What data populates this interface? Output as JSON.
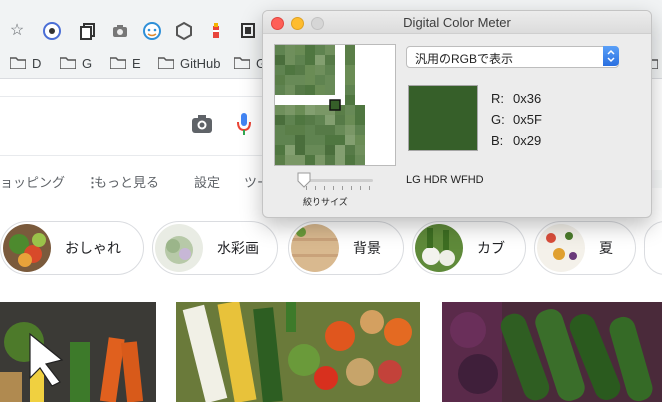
{
  "browser": {
    "bookmarks": [
      {
        "label": "D"
      },
      {
        "label": "G"
      },
      {
        "label": "E"
      },
      {
        "label": "GitHub"
      },
      {
        "label": "G"
      }
    ]
  },
  "google": {
    "tabs": [
      {
        "label": "ョッピング"
      },
      {
        "label": "もっと見る"
      },
      {
        "label": "設定"
      },
      {
        "label": "ツー"
      }
    ],
    "chips": [
      {
        "label": "おしゃれ"
      },
      {
        "label": "水彩画"
      },
      {
        "label": "背景"
      },
      {
        "label": "カブ"
      },
      {
        "label": "夏"
      }
    ]
  },
  "color_meter": {
    "title": "Digital Color Meter",
    "mode_select": "汎用のRGBで表示",
    "aperture_label": "絞りサイズ",
    "display_name": "LG HDR WFHD",
    "sampled_color": "#365F29",
    "r_label": "R:",
    "g_label": "G:",
    "b_label": "B:",
    "r_value": "0x36",
    "g_value": "0x5F",
    "b_value": "0x29",
    "aperture_fraction": 0.0
  }
}
